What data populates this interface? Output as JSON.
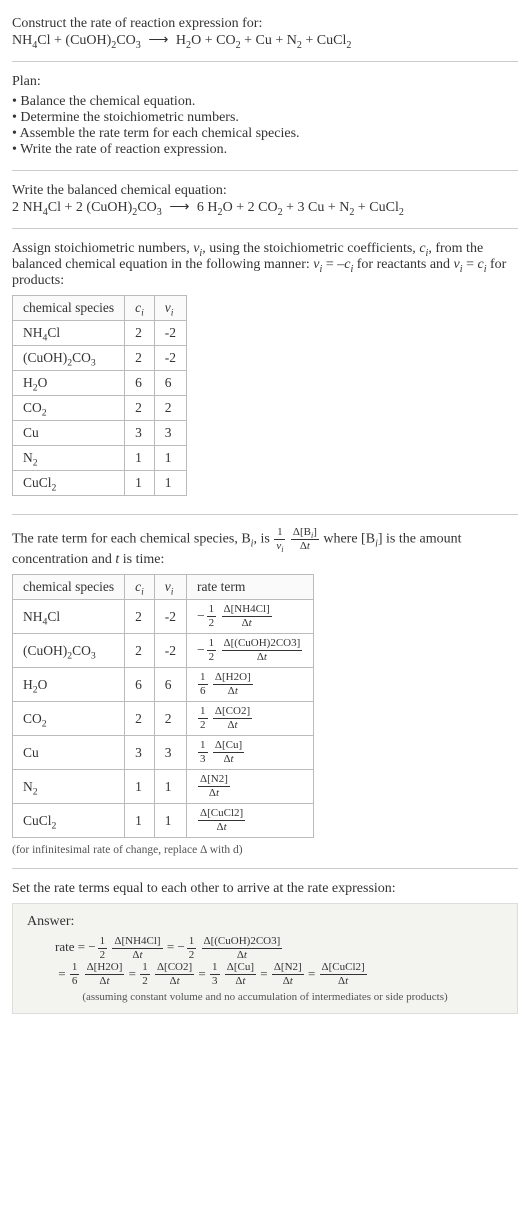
{
  "intro": {
    "line1": "Construct the rate of reaction expression for:"
  },
  "plan": {
    "heading": "Plan:",
    "items": [
      "Balance the chemical equation.",
      "Determine the stoichiometric numbers.",
      "Assemble the rate term for each chemical species.",
      "Write the rate of reaction expression."
    ]
  },
  "balanced_heading": "Write the balanced chemical equation:",
  "stoich_intro_a": "Assign stoichiometric numbers, ",
  "stoich_intro_b": ", using the stoichiometric coefficients, ",
  "stoich_intro_c": ", from the balanced chemical equation in the following manner: ",
  "stoich_intro_d": " for reactants and ",
  "stoich_intro_e": " for products:",
  "table1": {
    "headers": [
      "chemical species",
      "cᵢ",
      "νᵢ"
    ],
    "rows": [
      {
        "sp_html": "NH<sub>4</sub>Cl",
        "c": "2",
        "v": "-2"
      },
      {
        "sp_html": "(CuOH)<sub>2</sub>CO<sub>3</sub>",
        "c": "2",
        "v": "-2"
      },
      {
        "sp_html": "H<sub>2</sub>O",
        "c": "6",
        "v": "6"
      },
      {
        "sp_html": "CO<sub>2</sub>",
        "c": "2",
        "v": "2"
      },
      {
        "sp_html": "Cu",
        "c": "3",
        "v": "3"
      },
      {
        "sp_html": "N<sub>2</sub>",
        "c": "1",
        "v": "1"
      },
      {
        "sp_html": "CuCl<sub>2</sub>",
        "c": "1",
        "v": "1"
      }
    ]
  },
  "rate_term_intro_a": "The rate term for each chemical species, B",
  "rate_term_intro_b": ", is ",
  "rate_term_intro_c": " where [B",
  "rate_term_intro_d": "] is the amount concentration and ",
  "rate_term_intro_e": " is time:",
  "table2": {
    "headers": [
      "chemical species",
      "cᵢ",
      "νᵢ",
      "rate term"
    ]
  },
  "infinitesimal_note": "(for infinitesimal rate of change, replace Δ with d)",
  "set_equal": "Set the rate terms equal to each other to arrive at the rate expression:",
  "answer_label": "Answer:",
  "answer_note": "(assuming constant volume and no accumulation of intermediates or side products)",
  "chart_data": {
    "type": "table",
    "unbalanced_equation": {
      "reactants": [
        "NH4Cl",
        "(CuOH)2CO3"
      ],
      "products": [
        "H2O",
        "CO2",
        "Cu",
        "N2",
        "CuCl2"
      ]
    },
    "balanced_equation": {
      "reactants": [
        {
          "coef": 2,
          "species": "NH4Cl"
        },
        {
          "coef": 2,
          "species": "(CuOH)2CO3"
        }
      ],
      "products": [
        {
          "coef": 6,
          "species": "H2O"
        },
        {
          "coef": 2,
          "species": "CO2"
        },
        {
          "coef": 3,
          "species": "Cu"
        },
        {
          "coef": 1,
          "species": "N2"
        },
        {
          "coef": 1,
          "species": "CuCl2"
        }
      ]
    },
    "stoichiometry": [
      {
        "species": "NH4Cl",
        "c_i": 2,
        "nu_i": -2
      },
      {
        "species": "(CuOH)2CO3",
        "c_i": 2,
        "nu_i": -2
      },
      {
        "species": "H2O",
        "c_i": 6,
        "nu_i": 6
      },
      {
        "species": "CO2",
        "c_i": 2,
        "nu_i": 2
      },
      {
        "species": "Cu",
        "c_i": 3,
        "nu_i": 3
      },
      {
        "species": "N2",
        "c_i": 1,
        "nu_i": 1
      },
      {
        "species": "CuCl2",
        "c_i": 1,
        "nu_i": 1
      }
    ],
    "rate_terms": [
      {
        "species": "NH4Cl",
        "factor": "-1/2",
        "delta": "Δ[NH4Cl]/Δt"
      },
      {
        "species": "(CuOH)2CO3",
        "factor": "-1/2",
        "delta": "Δ[(CuOH)2CO3]/Δt"
      },
      {
        "species": "H2O",
        "factor": "1/6",
        "delta": "Δ[H2O]/Δt"
      },
      {
        "species": "CO2",
        "factor": "1/2",
        "delta": "Δ[CO2]/Δt"
      },
      {
        "species": "Cu",
        "factor": "1/3",
        "delta": "Δ[Cu]/Δt"
      },
      {
        "species": "N2",
        "factor": "1",
        "delta": "Δ[N2]/Δt"
      },
      {
        "species": "CuCl2",
        "factor": "1",
        "delta": "Δ[CuCl2]/Δt"
      }
    ],
    "rate_expression": "rate = -1/2 Δ[NH4Cl]/Δt = -1/2 Δ[(CuOH)2CO3]/Δt = 1/6 Δ[H2O]/Δt = 1/2 Δ[CO2]/Δt = 1/3 Δ[Cu]/Δt = Δ[N2]/Δt = Δ[CuCl2]/Δt"
  }
}
